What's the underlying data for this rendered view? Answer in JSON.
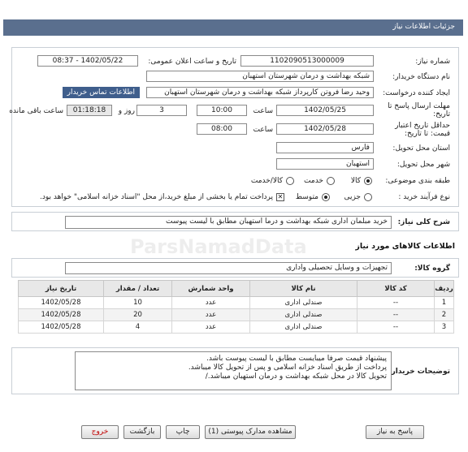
{
  "header": {
    "title": "جزئیات اطلاعات نیاز"
  },
  "fields": {
    "need_number_label": "شماره نیاز:",
    "need_number": "1102090513000009",
    "announce_label": "تاریخ و ساعت اعلان عمومی:",
    "announce_value": "1402/05/22 - 08:37",
    "buyer_label": "نام دستگاه خریدار:",
    "buyer_value": "شبکه بهداشت و درمان شهرستان استهبان",
    "requester_label": "ایجاد کننده درخواست:",
    "requester_value": "وحید رضا فروتن کارپرداز شبکه بهداشت و درمان شهرستان استهبان",
    "contact_link": "اطلاعات تماس خریدار",
    "deadline_label": "مهلت ارسال پاسخ تا تاریخ:",
    "deadline_date": "1402/05/25",
    "time_label": "ساعت",
    "deadline_time": "10:00",
    "days_value": "3",
    "days_label": "روز و",
    "remaining_value": "01:18:18",
    "remaining_label": "ساعت باقی مانده",
    "validity_label": "حداقل تاریخ اعتبار قیمت: تا تاریخ:",
    "validity_date": "1402/05/28",
    "validity_time_label": "ساعت",
    "validity_time": "08:00",
    "province_label": "استان محل تحویل:",
    "province_value": "فارس",
    "city_label": "شهر محل تحویل:",
    "city_value": "استهبان",
    "category_label": "طبقه بندی موضوعی:",
    "category_options": [
      "کالا",
      "خدمت",
      "کالا/خدمت"
    ],
    "process_label": "نوع فرآیند خرید :",
    "process_options": [
      "جزیی",
      "متوسط"
    ],
    "payment_note": "پرداخت تمام یا بخشی از مبلغ خرید،از محل \"اسناد خزانه اسلامی\" خواهد بود."
  },
  "summary": {
    "label": "شرح کلی نیاز:",
    "value": "خرید مبلمان اداری شبکه بهداشت و درما استهبان مطابق با لیست پیوست"
  },
  "goods": {
    "section_title": "اطلاعات کالاهای مورد نیاز",
    "group_label": "گروه کالا:",
    "group_value": "تجهیزات و وسایل تحصیلی واداری",
    "columns": [
      "ردیف",
      "کد کالا",
      "نام کالا",
      "واحد شمارش",
      "تعداد / مقدار",
      "تاریخ نیاز"
    ],
    "rows": [
      [
        "1",
        "--",
        "صندلی اداری",
        "عدد",
        "10",
        "1402/05/28"
      ],
      [
        "2",
        "--",
        "صندلی اداری",
        "عدد",
        "20",
        "1402/05/28"
      ],
      [
        "3",
        "--",
        "صندلی اداری",
        "عدد",
        "4",
        "1402/05/28"
      ]
    ]
  },
  "notes": {
    "label": "توضیحات خریدار:",
    "lines": [
      "پیشنهاد قیمت صرفا میبایست مطابق با لیست پیوست باشد.",
      "پرداخت از طریق اسناد خزانه اسلامی و پس از تحویل کالا میباشد.",
      "تحویل کالا در محل شبکه بهداشت و درمان استهبان میباشد./"
    ]
  },
  "watermark": "ParsNamadData",
  "buttons": {
    "reply": "پاسخ به نیاز",
    "attachments": "مشاهده مدارک پیوستی (1)",
    "print": "چاپ",
    "back": "بازگشت",
    "exit": "خروج"
  }
}
